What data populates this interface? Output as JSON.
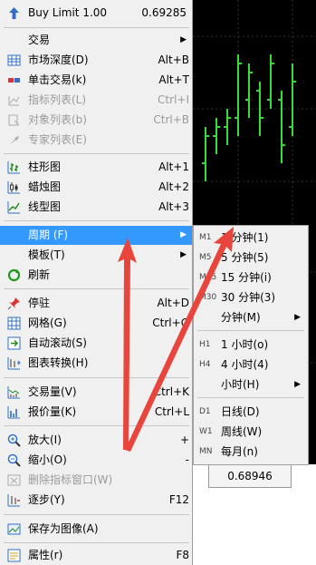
{
  "menu": {
    "header": {
      "label": "Buy Limit 1.00",
      "value": "0.69285"
    },
    "items": [
      {
        "label": "交易",
        "shortcut": "",
        "submenu": true
      },
      {
        "label": "市场深度(D)",
        "shortcut": "Alt+B"
      },
      {
        "label": "单击交易(k)",
        "shortcut": "Alt+T"
      },
      {
        "label": "指标列表(L)",
        "shortcut": "Ctrl+I"
      },
      {
        "label": "对象列表(b)",
        "shortcut": "Ctrl+B"
      },
      {
        "label": "专家列表(E)",
        "shortcut": ""
      },
      {
        "label": "柱形图",
        "shortcut": "Alt+1"
      },
      {
        "label": "蜡烛图",
        "shortcut": "Alt+2"
      },
      {
        "label": "线型图",
        "shortcut": "Alt+3"
      },
      {
        "label": "周期 (F)",
        "shortcut": "",
        "submenu": true
      },
      {
        "label": "模板(T)",
        "shortcut": "",
        "submenu": true
      },
      {
        "label": "刷新",
        "shortcut": ""
      },
      {
        "label": "停驻",
        "shortcut": "Alt+D"
      },
      {
        "label": "网格(G)",
        "shortcut": "Ctrl+G"
      },
      {
        "label": "自动滚动(S)",
        "shortcut": ""
      },
      {
        "label": "图表转换(H)",
        "shortcut": ""
      },
      {
        "label": "交易量(V)",
        "shortcut": "Ctrl+K"
      },
      {
        "label": "报价量(K)",
        "shortcut": "Ctrl+L"
      },
      {
        "label": "放大(I)",
        "shortcut": "+"
      },
      {
        "label": "缩小(O)",
        "shortcut": "-"
      },
      {
        "label": "删除指标窗口(W)",
        "shortcut": ""
      },
      {
        "label": "逐步(Y)",
        "shortcut": "F12"
      },
      {
        "label": "保存为图像(A)",
        "shortcut": ""
      },
      {
        "label": "属性(r)",
        "shortcut": "F8"
      }
    ]
  },
  "submenu": {
    "items": [
      {
        "tag": "M1",
        "label": "1 分钟(1)"
      },
      {
        "tag": "M5",
        "label": "5 分钟(5)"
      },
      {
        "tag": "M15",
        "label": "15 分钟(i)"
      },
      {
        "tag": "M30",
        "label": "30 分钟(3)"
      },
      {
        "tag": "",
        "label": "分钟(M)",
        "submenu": true
      },
      {
        "tag": "H1",
        "label": "1 小时(o)"
      },
      {
        "tag": "H4",
        "label": "4 小时(4)"
      },
      {
        "tag": "",
        "label": "小时(H)",
        "submenu": true
      },
      {
        "tag": "D1",
        "label": "日线(D)"
      },
      {
        "tag": "W1",
        "label": "周线(W)"
      },
      {
        "tag": "MN",
        "label": "每月(n)"
      }
    ]
  },
  "chart": {
    "price_label": "0.68946"
  },
  "colors": {
    "highlight": "#3399ff",
    "arrow": "#e8463c",
    "candle": "#33dd33"
  }
}
